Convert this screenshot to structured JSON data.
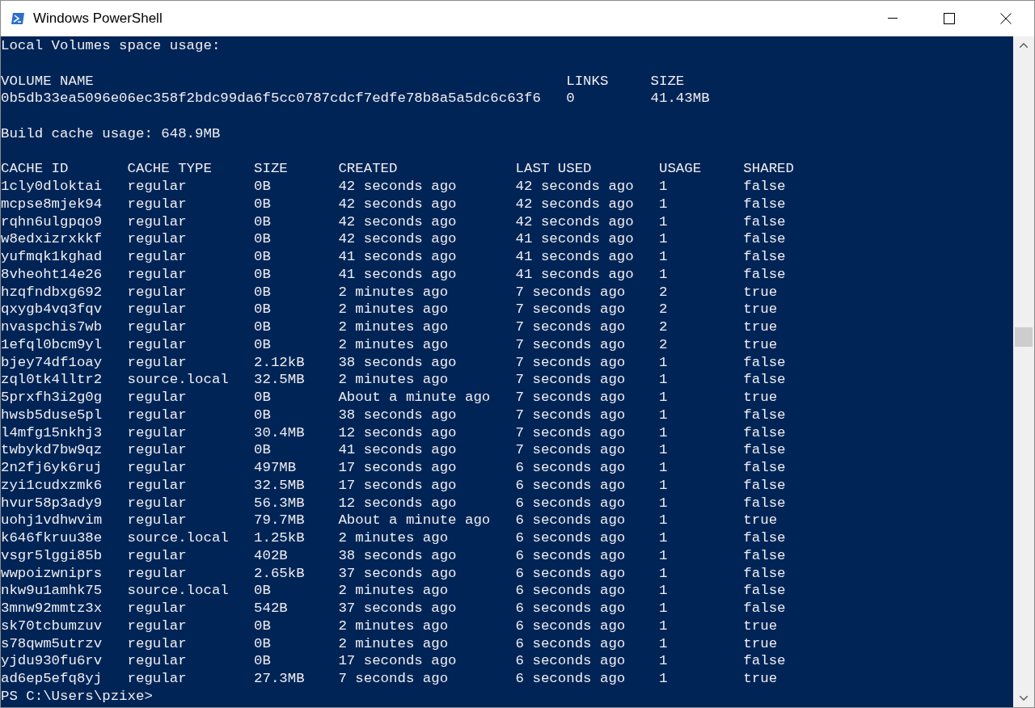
{
  "window": {
    "title": "Windows PowerShell"
  },
  "volumes_heading": "Local Volumes space usage:",
  "volumes_table": {
    "columns": [
      "VOLUME NAME",
      "LINKS",
      "SIZE"
    ],
    "rows": [
      [
        "0b5db33ea5096e06ec358f2bdc99da6f5cc0787cdcf7edfe78b8a5a5dc6c63f6",
        "0",
        "41.43MB"
      ]
    ]
  },
  "build_cache_line": "Build cache usage: 648.9MB",
  "cache_table": {
    "columns": [
      "CACHE ID",
      "CACHE TYPE",
      "SIZE",
      "CREATED",
      "LAST USED",
      "USAGE",
      "SHARED"
    ],
    "rows": [
      [
        "1cly0dloktai",
        "regular",
        "0B",
        "42 seconds ago",
        "42 seconds ago",
        "1",
        "false"
      ],
      [
        "mcpse8mjek94",
        "regular",
        "0B",
        "42 seconds ago",
        "42 seconds ago",
        "1",
        "false"
      ],
      [
        "rqhn6ulgpqo9",
        "regular",
        "0B",
        "42 seconds ago",
        "42 seconds ago",
        "1",
        "false"
      ],
      [
        "w8edxizrxkkf",
        "regular",
        "0B",
        "42 seconds ago",
        "41 seconds ago",
        "1",
        "false"
      ],
      [
        "yufmqk1kghad",
        "regular",
        "0B",
        "41 seconds ago",
        "41 seconds ago",
        "1",
        "false"
      ],
      [
        "8vheoht14e26",
        "regular",
        "0B",
        "41 seconds ago",
        "41 seconds ago",
        "1",
        "false"
      ],
      [
        "hzqfndbxg692",
        "regular",
        "0B",
        "2 minutes ago",
        "7 seconds ago",
        "2",
        "true"
      ],
      [
        "qxygb4vq3fqv",
        "regular",
        "0B",
        "2 minutes ago",
        "7 seconds ago",
        "2",
        "true"
      ],
      [
        "nvaspchis7wb",
        "regular",
        "0B",
        "2 minutes ago",
        "7 seconds ago",
        "2",
        "true"
      ],
      [
        "1efql0bcm9yl",
        "regular",
        "0B",
        "2 minutes ago",
        "7 seconds ago",
        "2",
        "true"
      ],
      [
        "bjey74df1oay",
        "regular",
        "2.12kB",
        "38 seconds ago",
        "7 seconds ago",
        "1",
        "false"
      ],
      [
        "zql0tk4lltr2",
        "source.local",
        "32.5MB",
        "2 minutes ago",
        "7 seconds ago",
        "1",
        "false"
      ],
      [
        "5prxfh3i2g0g",
        "regular",
        "0B",
        "About a minute ago",
        "7 seconds ago",
        "1",
        "true"
      ],
      [
        "hwsb5duse5pl",
        "regular",
        "0B",
        "38 seconds ago",
        "7 seconds ago",
        "1",
        "false"
      ],
      [
        "l4mfg15nkhj3",
        "regular",
        "30.4MB",
        "12 seconds ago",
        "7 seconds ago",
        "1",
        "false"
      ],
      [
        "twbykd7bw9qz",
        "regular",
        "0B",
        "41 seconds ago",
        "7 seconds ago",
        "1",
        "false"
      ],
      [
        "2n2fj6yk6ruj",
        "regular",
        "497MB",
        "17 seconds ago",
        "6 seconds ago",
        "1",
        "false"
      ],
      [
        "zyi1cudxzmk6",
        "regular",
        "32.5MB",
        "17 seconds ago",
        "6 seconds ago",
        "1",
        "false"
      ],
      [
        "hvur58p3ady9",
        "regular",
        "56.3MB",
        "12 seconds ago",
        "6 seconds ago",
        "1",
        "false"
      ],
      [
        "uohj1vdhwvim",
        "regular",
        "79.7MB",
        "About a minute ago",
        "6 seconds ago",
        "1",
        "true"
      ],
      [
        "k646fkruu38e",
        "source.local",
        "1.25kB",
        "2 minutes ago",
        "6 seconds ago",
        "1",
        "false"
      ],
      [
        "vsgr5lggi85b",
        "regular",
        "402B",
        "38 seconds ago",
        "6 seconds ago",
        "1",
        "false"
      ],
      [
        "wwpoizwniprs",
        "regular",
        "2.65kB",
        "37 seconds ago",
        "6 seconds ago",
        "1",
        "false"
      ],
      [
        "nkw9u1amhk75",
        "source.local",
        "0B",
        "2 minutes ago",
        "6 seconds ago",
        "1",
        "false"
      ],
      [
        "3mnw92mmtz3x",
        "regular",
        "542B",
        "37 seconds ago",
        "6 seconds ago",
        "1",
        "false"
      ],
      [
        "sk70tcbumzuv",
        "regular",
        "0B",
        "2 minutes ago",
        "6 seconds ago",
        "1",
        "true"
      ],
      [
        "s78qwm5utrzv",
        "regular",
        "0B",
        "2 minutes ago",
        "6 seconds ago",
        "1",
        "true"
      ],
      [
        "yjdu930fu6rv",
        "regular",
        "0B",
        "17 seconds ago",
        "6 seconds ago",
        "1",
        "false"
      ],
      [
        "ad6ep5efq8yj",
        "regular",
        "27.3MB",
        "7 seconds ago",
        "6 seconds ago",
        "1",
        "true"
      ]
    ]
  },
  "prompt": "PS C:\\Users\\pzixe>"
}
